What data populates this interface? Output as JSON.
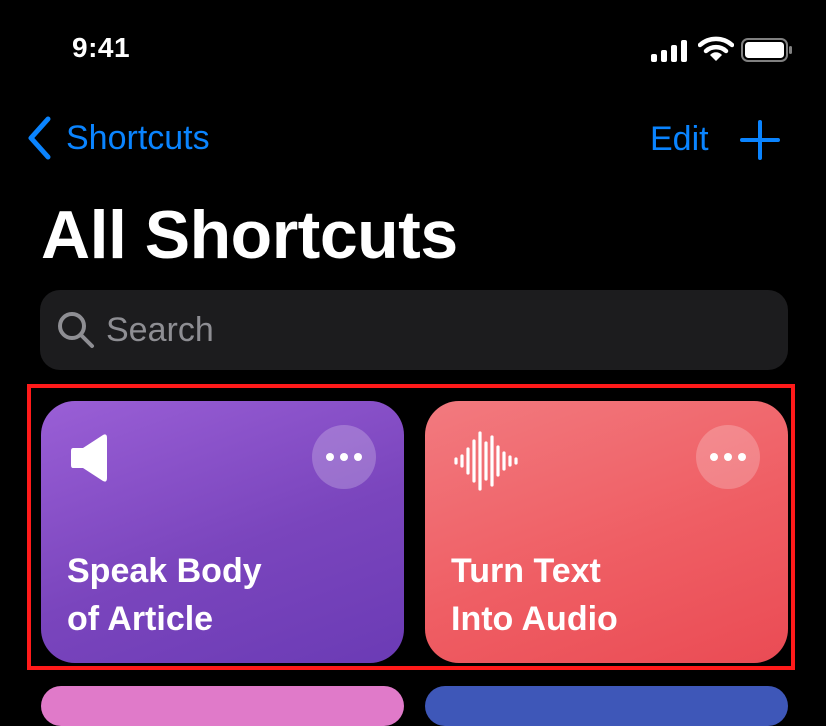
{
  "status_bar": {
    "time": "9:41"
  },
  "nav": {
    "back_label": "Shortcuts",
    "edit_label": "Edit"
  },
  "header": {
    "title": "All Shortcuts"
  },
  "search": {
    "placeholder": "Search"
  },
  "shortcuts": [
    {
      "line1": "Speak Body",
      "line2": "of Article",
      "icon": "speaker-icon",
      "color": "#7b46be"
    },
    {
      "line1": "Turn Text",
      "line2": "Into Audio",
      "icon": "waveform-icon",
      "color": "#ee5a61"
    }
  ],
  "colors": {
    "accent": "#0a84ff",
    "highlight": "#ff1a1a",
    "peek_pink": "#e07ac9",
    "peek_blue": "#3e57b8"
  }
}
